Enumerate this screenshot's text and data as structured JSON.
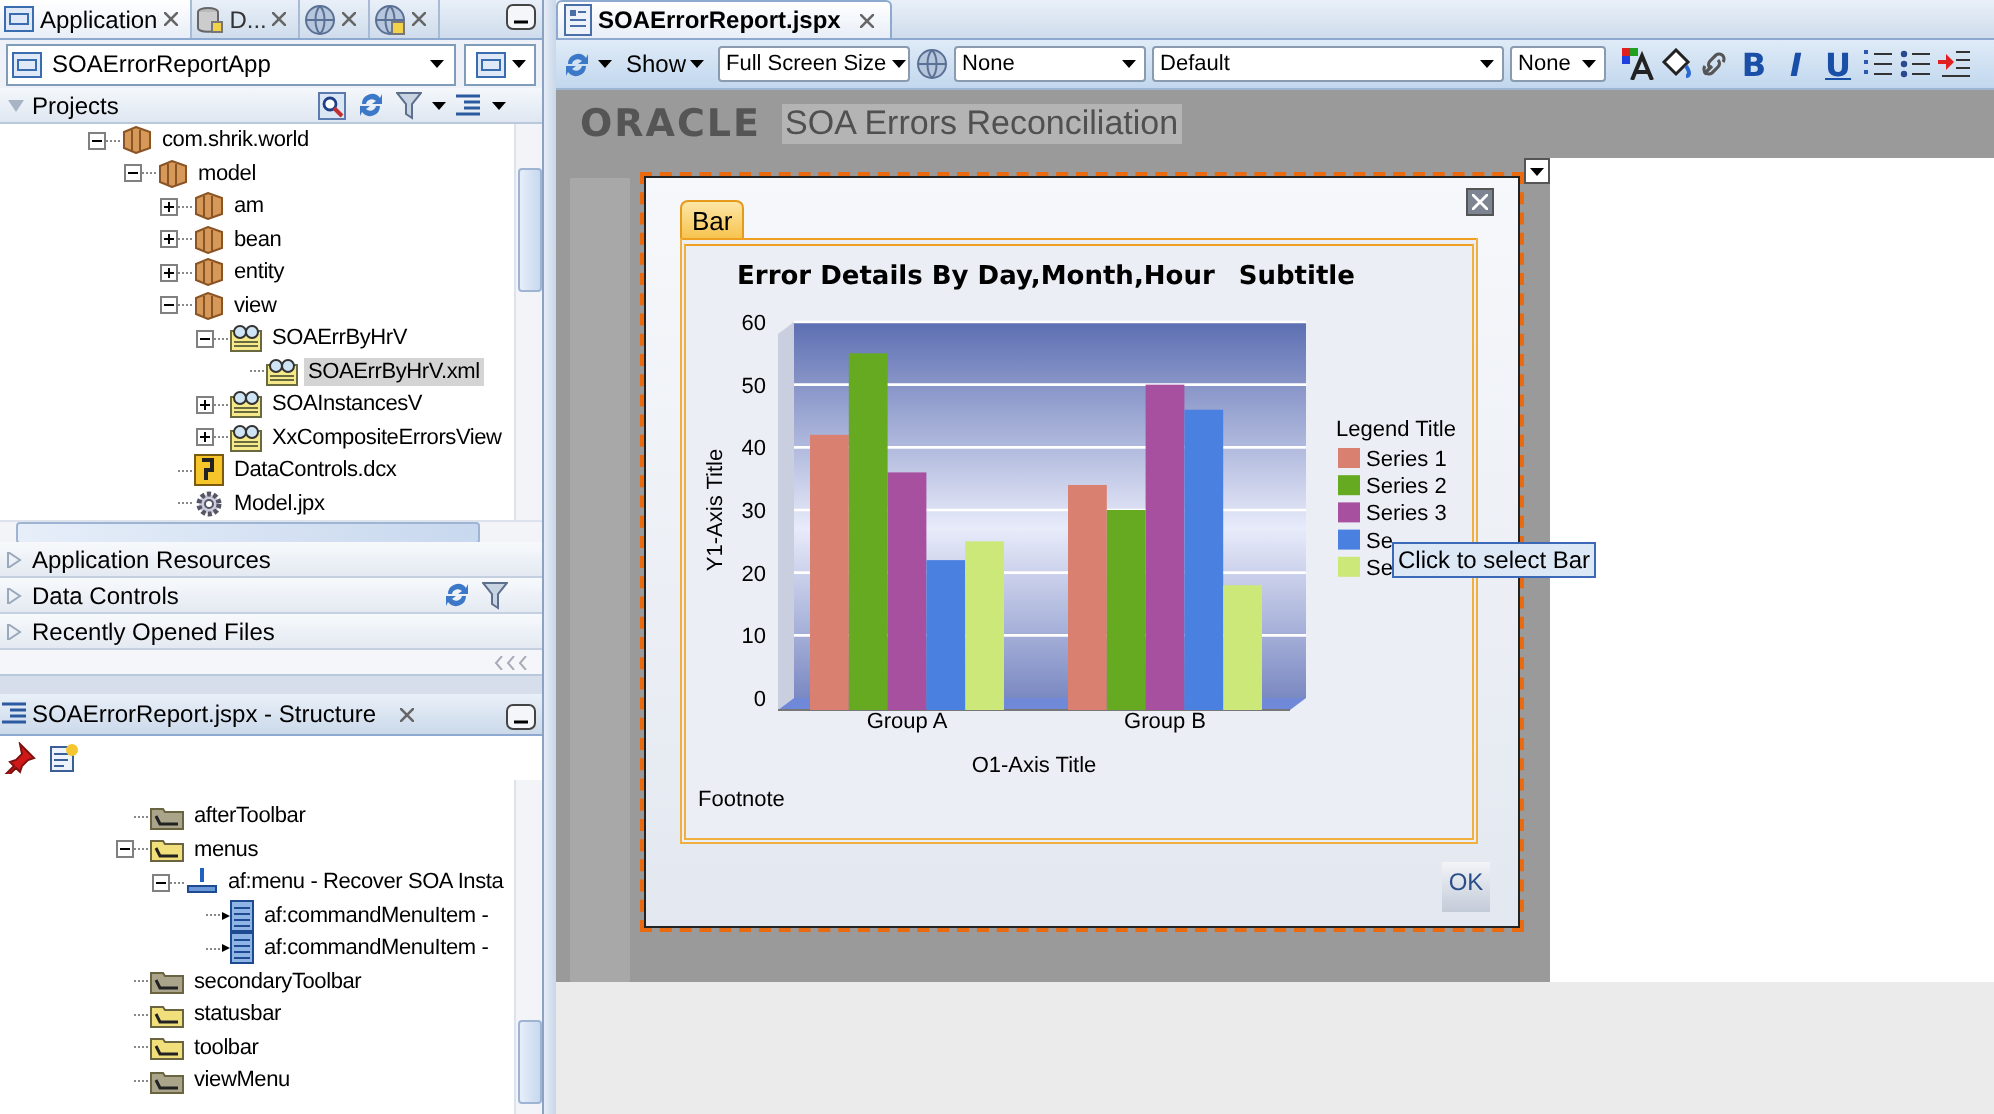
{
  "left_panel": {
    "tabs": [
      {
        "label": "Application",
        "kind": "application",
        "selected": true
      },
      {
        "label": "D...",
        "kind": "database",
        "selected": false
      },
      {
        "kind": "globe",
        "selected": false
      },
      {
        "kind": "globedb",
        "selected": false
      }
    ],
    "app_selector": {
      "value": "SOAErrorReportApp"
    },
    "projects": {
      "title": "Projects",
      "expanded": true,
      "tree": [
        {
          "label": "com.shrik.world",
          "kind": "package",
          "expanded": true,
          "selected": false,
          "children": [
            {
              "label": "model",
              "kind": "package",
              "expanded": true,
              "selected": false,
              "children": [
                {
                  "label": "am",
                  "kind": "package",
                  "expanded": false,
                  "selected": false
                },
                {
                  "label": "bean",
                  "kind": "package",
                  "expanded": false,
                  "selected": false
                },
                {
                  "label": "entity",
                  "kind": "package",
                  "expanded": false,
                  "selected": false
                },
                {
                  "label": "view",
                  "kind": "package",
                  "expanded": true,
                  "selected": false,
                  "children": [
                    {
                      "label": "SOAErrByHrV",
                      "kind": "viewobject",
                      "expanded": true,
                      "selected": false,
                      "children": [
                        {
                          "label": "SOAErrByHrV.xml",
                          "kind": "viewobject",
                          "selected": true
                        }
                      ]
                    },
                    {
                      "label": "SOAInstancesV",
                      "kind": "viewobject",
                      "expanded": false,
                      "selected": false
                    },
                    {
                      "label": "XxCompositeErrorsView",
                      "kind": "viewobject",
                      "expanded": false,
                      "selected": false
                    }
                  ]
                },
                {
                  "label": "DataControls.dcx",
                  "kind": "datacontrol",
                  "selected": false
                },
                {
                  "label": "Model.jpx",
                  "kind": "config",
                  "selected": false
                }
              ]
            }
          ]
        }
      ]
    },
    "accordion": [
      {
        "label": "Application Resources",
        "kind": "plain",
        "expanded": false
      },
      {
        "label": "Data Controls",
        "kind": "tools",
        "expanded": false
      },
      {
        "label": "Recently Opened Files",
        "kind": "plain",
        "expanded": false
      }
    ]
  },
  "structure_panel": {
    "tab": {
      "label": "SOAErrorReport.jspx - Structure",
      "selected": true
    },
    "tree": [
      {
        "label": "afterToolbar",
        "kind": "emptyfacet",
        "selected": false
      },
      {
        "label": "menus",
        "kind": "facet",
        "expanded": true,
        "selected": false,
        "children": [
          {
            "label": "af:menu - Recover SOA Insta",
            "kind": "menu",
            "expanded": true,
            "selected": false,
            "children": [
              {
                "label": "af:commandMenuItem -",
                "kind": "menuitem",
                "selected": false
              },
              {
                "label": "af:commandMenuItem -",
                "kind": "menuitem",
                "selected": false
              }
            ]
          }
        ]
      },
      {
        "label": "secondaryToolbar",
        "kind": "emptyfacet",
        "selected": false
      },
      {
        "label": "statusbar",
        "kind": "facet",
        "selected": false
      },
      {
        "label": "toolbar",
        "kind": "facet",
        "selected": false
      },
      {
        "label": "viewMenu",
        "kind": "emptyfacet",
        "selected": false
      }
    ]
  },
  "editor": {
    "tab": {
      "label": "SOAErrorReport.jspx",
      "selected": true
    },
    "toolbar": {
      "show_label": "Show",
      "selects": [
        {
          "value": "Full Screen Size"
        },
        {
          "value": "None"
        },
        {
          "value": "Default"
        },
        {
          "value": "None"
        }
      ],
      "format_buttons": [
        "B",
        "I",
        "U"
      ]
    },
    "page": {
      "logo": "ORACLE",
      "title": "SOA Errors Reconciliation",
      "dialog": {
        "tabs": [
          {
            "label": "Bar",
            "selected": true
          }
        ],
        "chart_data": {
          "type": "bar",
          "title": "Error Details By Day,Month,Hour",
          "xlabel": "O1-Axis Title",
          "ylabel": "Y1-Axis Title",
          "categories": [
            "Group A",
            "Group B"
          ],
          "series": [
            {
              "name": "Series 1",
              "color": "#d98070",
              "values": [
                42,
                34
              ]
            },
            {
              "name": "Series 2",
              "color": "#66aa22",
              "values": [
                55,
                30
              ]
            },
            {
              "name": "Series 3",
              "color": "#a850a0",
              "values": [
                36,
                50
              ]
            },
            {
              "name": "Se",
              "color": "#4a80e0",
              "values": [
                22,
                46
              ]
            },
            {
              "name": "Se",
              "color": "#cce878",
              "values": [
                25,
                18
              ]
            }
          ],
          "ylim": [
            0,
            60
          ],
          "yticks": [
            0,
            10,
            20,
            30,
            40,
            50,
            60
          ],
          "grid": true,
          "legend": "right"
        },
        "subtitle": "Subtitle",
        "legend_title": "Legend Title",
        "footnote": "Footnote",
        "button": "OK",
        "tooltip": "Click to select Bar"
      }
    }
  }
}
